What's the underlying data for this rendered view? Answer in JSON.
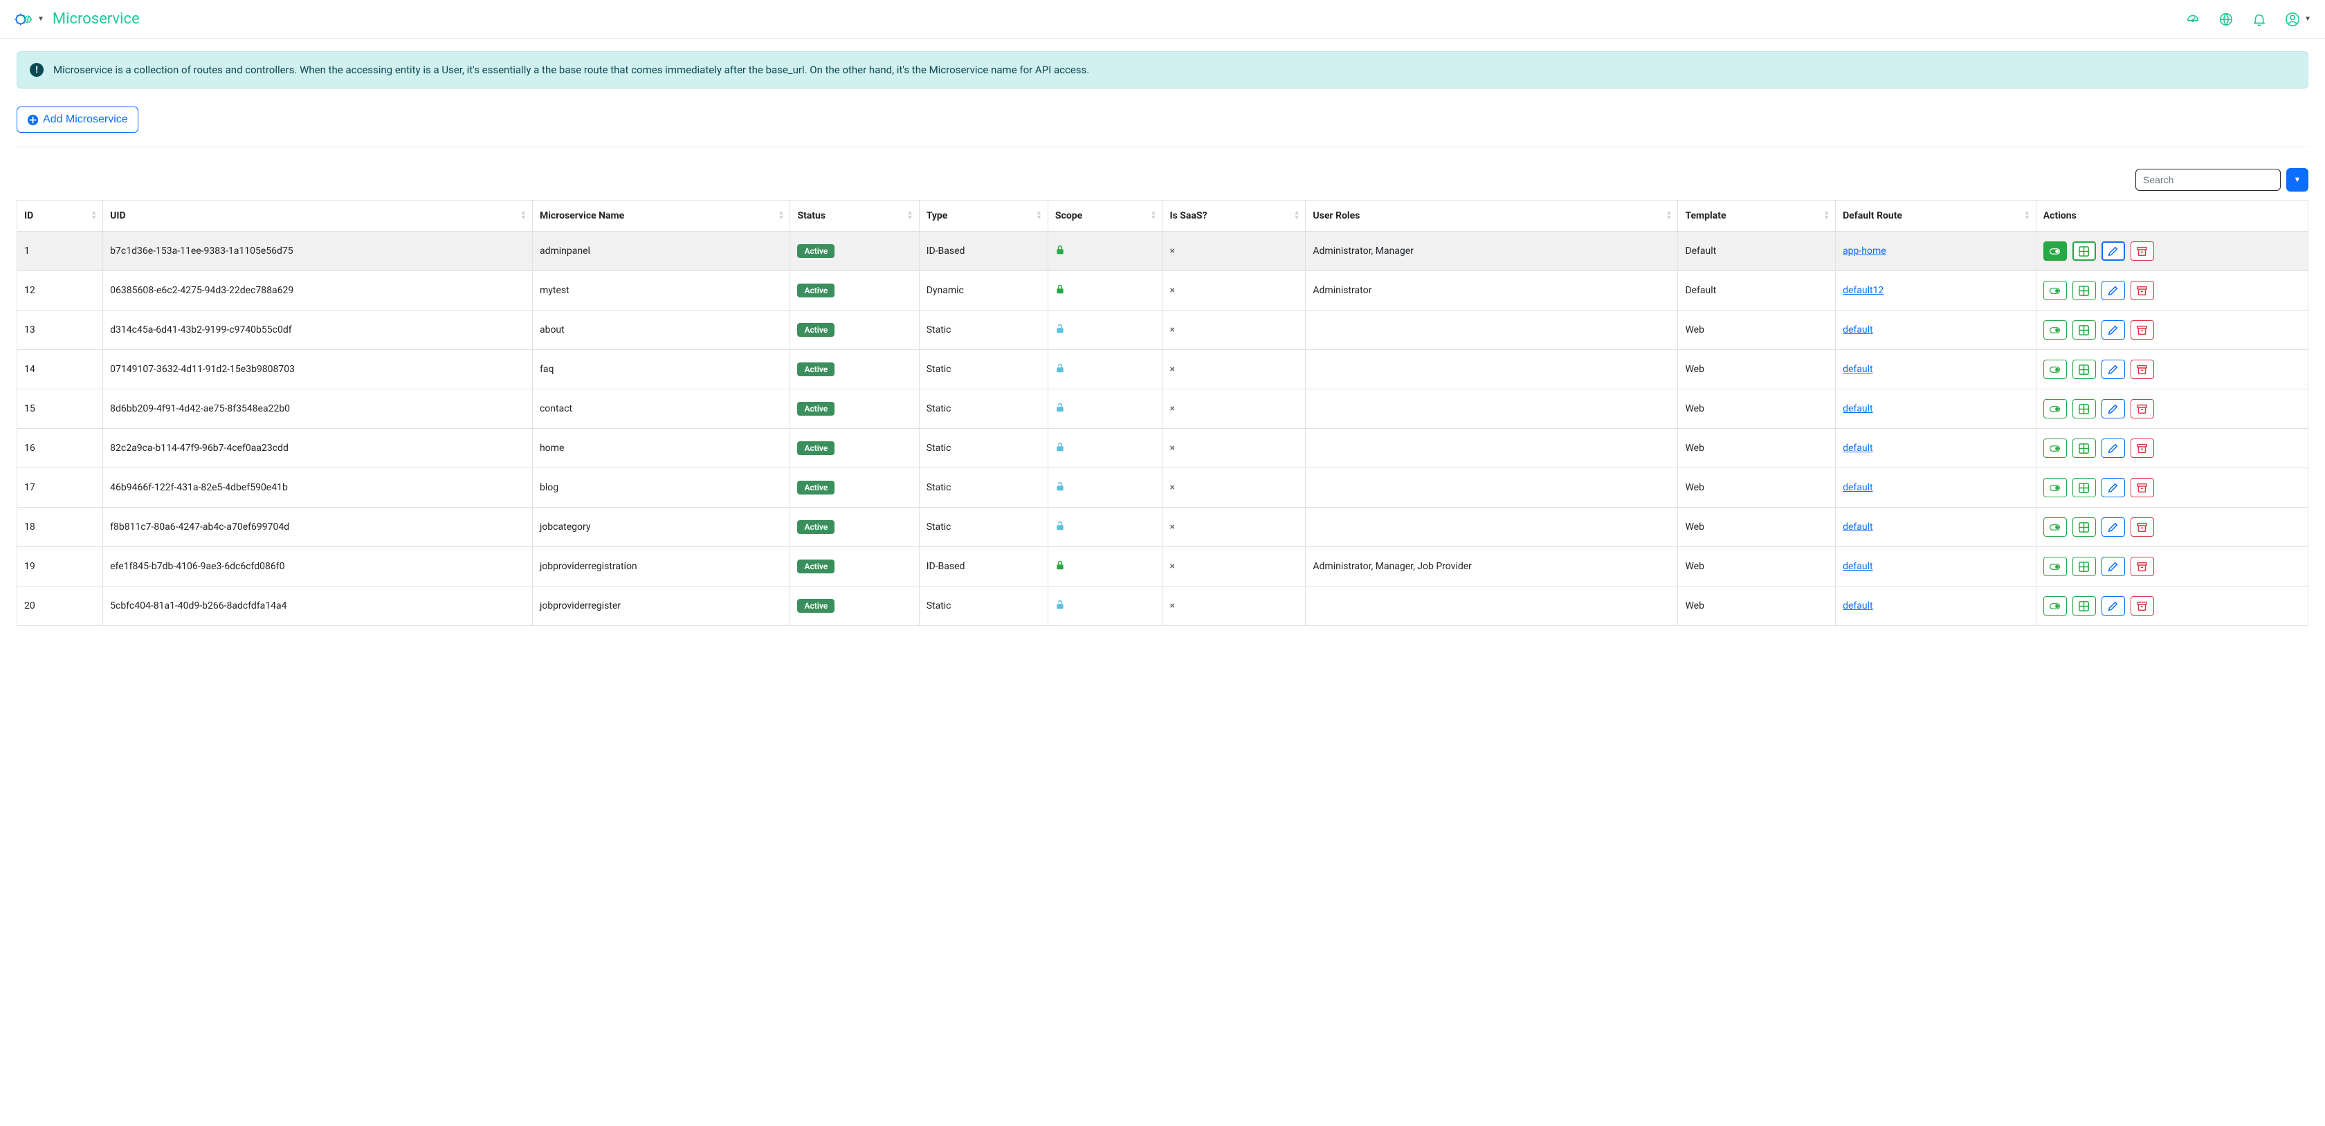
{
  "header": {
    "page_name": "Microservice"
  },
  "banner": {
    "text": "Microservice is a collection of routes and controllers. When the accessing entity is a User, it's essentially a the base route that comes immediately after the base_url. On the other hand, it's the Microservice name for API access."
  },
  "buttons": {
    "add_label": "Add Microservice"
  },
  "search": {
    "placeholder": "Search"
  },
  "table": {
    "columns": {
      "id": "ID",
      "uid": "UID",
      "name": "Microservice Name",
      "status": "Status",
      "type": "Type",
      "scope": "Scope",
      "saas": "Is SaaS?",
      "roles": "User Roles",
      "template": "Template",
      "route": "Default Route",
      "actions": "Actions"
    },
    "status_label": "Active",
    "rows": [
      {
        "id": "1",
        "uid": "b7c1d36e-153a-11ee-9383-1a1105e56d75",
        "name": "adminpanel",
        "type": "ID-Based",
        "locked": true,
        "roles": "Administrator, Manager",
        "template": "Default",
        "route": "app-home",
        "selected": true
      },
      {
        "id": "12",
        "uid": "06385608-e6c2-4275-94d3-22dec788a629",
        "name": "mytest",
        "type": "Dynamic",
        "locked": true,
        "roles": "Administrator",
        "template": "Default",
        "route": "default12",
        "selected": false
      },
      {
        "id": "13",
        "uid": "d314c45a-6d41-43b2-9199-c9740b55c0df",
        "name": "about",
        "type": "Static",
        "locked": false,
        "roles": "",
        "template": "Web",
        "route": "default",
        "selected": false
      },
      {
        "id": "14",
        "uid": "07149107-3632-4d11-91d2-15e3b9808703",
        "name": "faq",
        "type": "Static",
        "locked": false,
        "roles": "",
        "template": "Web",
        "route": "default",
        "selected": false
      },
      {
        "id": "15",
        "uid": "8d6bb209-4f91-4d42-ae75-8f3548ea22b0",
        "name": "contact",
        "type": "Static",
        "locked": false,
        "roles": "",
        "template": "Web",
        "route": "default",
        "selected": false
      },
      {
        "id": "16",
        "uid": "82c2a9ca-b114-47f9-96b7-4cef0aa23cdd",
        "name": "home",
        "type": "Static",
        "locked": false,
        "roles": "",
        "template": "Web",
        "route": "default",
        "selected": false
      },
      {
        "id": "17",
        "uid": "46b9466f-122f-431a-82e5-4dbef590e41b",
        "name": "blog",
        "type": "Static",
        "locked": false,
        "roles": "",
        "template": "Web",
        "route": "default",
        "selected": false
      },
      {
        "id": "18",
        "uid": "f8b811c7-80a6-4247-ab4c-a70ef699704d",
        "name": "jobcategory",
        "type": "Static",
        "locked": false,
        "roles": "",
        "template": "Web",
        "route": "default",
        "selected": false
      },
      {
        "id": "19",
        "uid": "efe1f845-b7db-4106-9ae3-6dc6cfd086f0",
        "name": "jobproviderregistration",
        "type": "ID-Based",
        "locked": true,
        "roles": "Administrator, Manager, Job Provider",
        "template": "Web",
        "route": "default",
        "selected": false
      },
      {
        "id": "20",
        "uid": "5cbfc404-81a1-40d9-b266-8adcfdfa14a4",
        "name": "jobproviderregister",
        "type": "Static",
        "locked": false,
        "roles": "",
        "template": "Web",
        "route": "default",
        "selected": false
      }
    ]
  }
}
